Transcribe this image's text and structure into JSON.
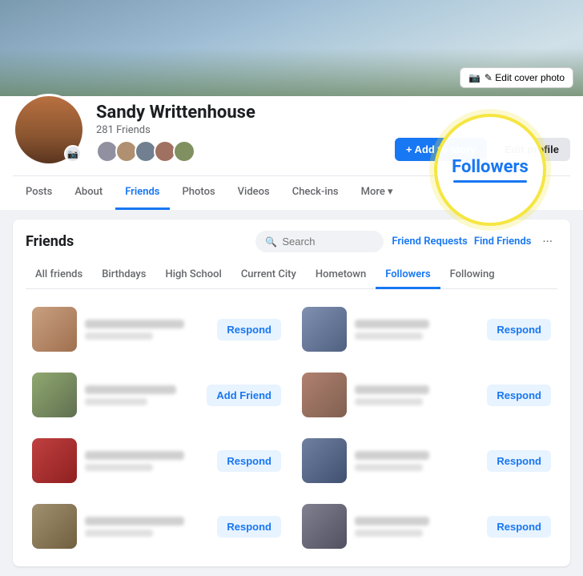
{
  "profile": {
    "name": "Sandy Writtenhouse",
    "friends_count": "281 Friends",
    "cover_edit_label": "✎ Edit cover photo"
  },
  "nav": {
    "items": [
      {
        "label": "Posts",
        "active": false
      },
      {
        "label": "About",
        "active": false
      },
      {
        "label": "Friends",
        "active": true
      },
      {
        "label": "Photos",
        "active": false
      },
      {
        "label": "Videos",
        "active": false
      },
      {
        "label": "Check-ins",
        "active": false
      },
      {
        "label": "More ▾",
        "active": false
      }
    ]
  },
  "actions": {
    "add_story": "+ Add to story",
    "edit_profile": "Edit profile"
  },
  "friends_panel": {
    "title": "Friends",
    "search_placeholder": "Search",
    "friend_requests_label": "Friend Requests",
    "find_friends_label": "Find Friends",
    "dots_label": "···"
  },
  "subtabs": [
    {
      "label": "All friends",
      "active": false
    },
    {
      "label": "Birthdays",
      "active": false
    },
    {
      "label": "High School",
      "active": false
    },
    {
      "label": "Current City",
      "active": false
    },
    {
      "label": "Hometown",
      "active": false
    },
    {
      "label": "Followers",
      "active": true
    },
    {
      "label": "Following",
      "active": false
    }
  ],
  "followers_highlight": {
    "text": "Followers"
  },
  "friends": [
    {
      "avatar_class": "fa-1",
      "btn": "Respond",
      "btn_type": "respond"
    },
    {
      "avatar_class": "fa-2",
      "btn": "Respond",
      "btn_type": "respond"
    },
    {
      "avatar_class": "fa-3",
      "btn": "Add Friend",
      "btn_type": "add"
    },
    {
      "avatar_class": "fa-4",
      "btn": "Respond",
      "btn_type": "respond"
    },
    {
      "avatar_class": "fa-5",
      "btn": "Respond",
      "btn_type": "respond"
    },
    {
      "avatar_class": "fa-6",
      "btn": "Respond",
      "btn_type": "respond"
    },
    {
      "avatar_class": "fa-7",
      "btn": "Respond",
      "btn_type": "respond"
    },
    {
      "avatar_class": "fa-8",
      "btn": "Respond",
      "btn_type": "respond"
    }
  ]
}
